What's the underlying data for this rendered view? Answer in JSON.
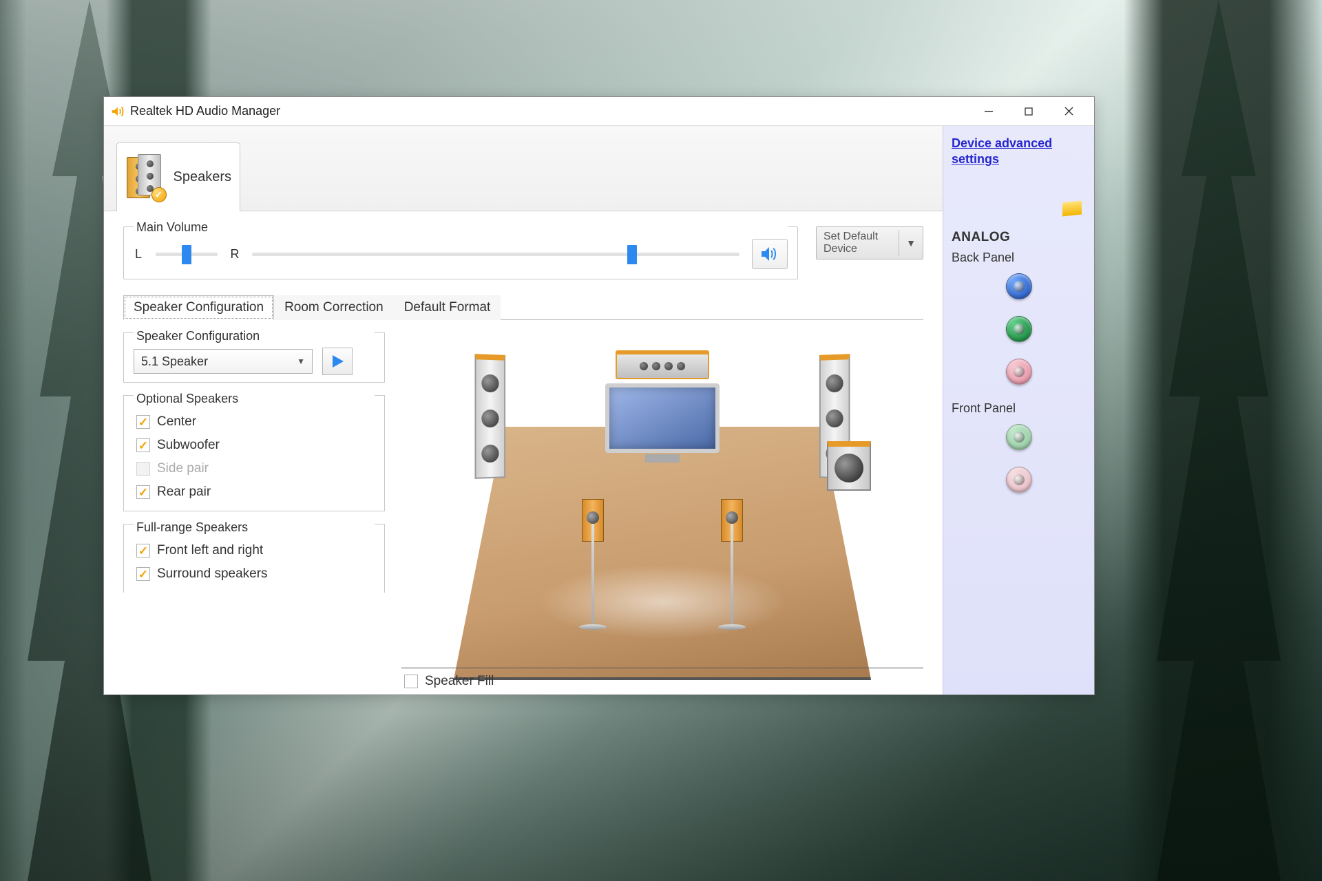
{
  "window": {
    "title": "Realtek HD Audio Manager"
  },
  "device_tab": {
    "label": "Speakers"
  },
  "volume": {
    "heading": "Main Volume",
    "balance_left": "L",
    "balance_right": "R",
    "balance_pct": 50,
    "level_pct": 78,
    "default_button": "Set Default Device"
  },
  "tabs": {
    "speaker_config": "Speaker Configuration",
    "room_correction": "Room Correction",
    "default_format": "Default Format",
    "active": "speaker_config"
  },
  "speaker_config": {
    "heading": "Speaker Configuration",
    "selected": "5.1 Speaker"
  },
  "optional": {
    "heading": "Optional Speakers",
    "center": {
      "label": "Center",
      "checked": true,
      "enabled": true
    },
    "subwoofer": {
      "label": "Subwoofer",
      "checked": true,
      "enabled": true
    },
    "side_pair": {
      "label": "Side pair",
      "checked": false,
      "enabled": false
    },
    "rear_pair": {
      "label": "Rear pair",
      "checked": true,
      "enabled": true
    }
  },
  "fullrange": {
    "heading": "Full-range Speakers",
    "front_lr": {
      "label": "Front left and right",
      "checked": true
    },
    "surround": {
      "label": "Surround speakers",
      "checked": true
    }
  },
  "speaker_fill": {
    "label": "Speaker Fill",
    "checked": false
  },
  "side": {
    "advanced_link": "Device advanced settings",
    "analog": "ANALOG",
    "back_panel": "Back Panel",
    "front_panel": "Front Panel"
  }
}
